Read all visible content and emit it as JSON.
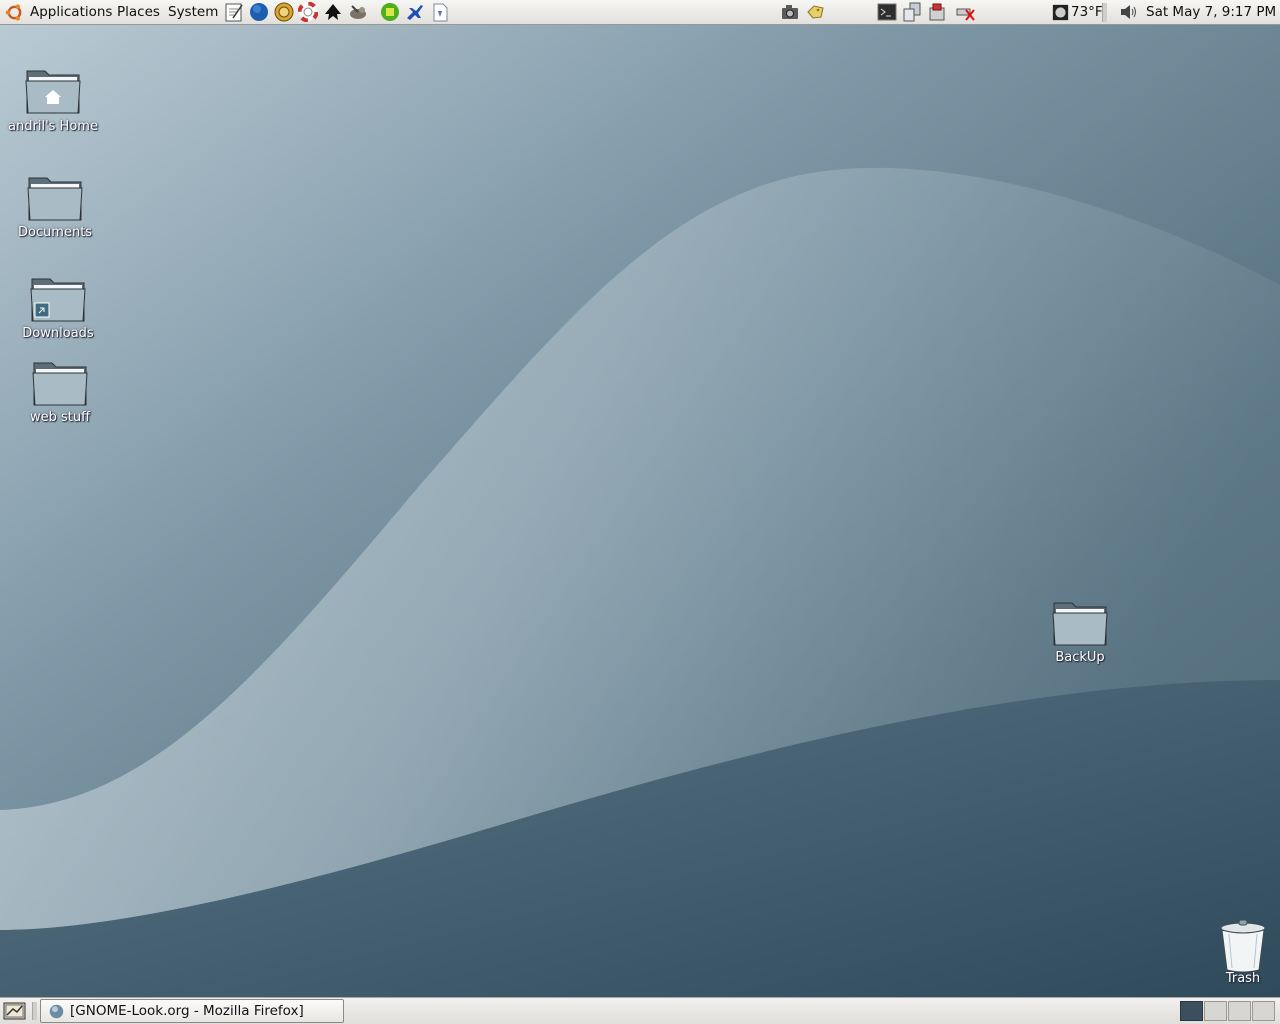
{
  "top_panel": {
    "menus": [
      "Applications",
      "Places",
      "System"
    ],
    "launchers": [
      "text-editor-icon",
      "globe-browser-icon",
      "tools-icon",
      "help-lifebuoy-icon",
      "inkscape-icon",
      "gimp-icon",
      "games-icon",
      "jet-icon",
      "document-icon"
    ],
    "tray_left": [
      "camera-icon",
      "tag-icon"
    ],
    "tray_right": [
      "terminal-icon",
      "windows-icon",
      "network-icon",
      "battery-disconnected-icon"
    ],
    "weather": "73°F",
    "volume_icon": "speaker-icon",
    "clock": "Sat May  7,  9:17 PM"
  },
  "desktop": {
    "icons": [
      {
        "label": "andril's Home",
        "type": "home-folder-icon"
      },
      {
        "label": "Documents",
        "type": "folder-icon"
      },
      {
        "label": "Downloads",
        "type": "link-folder-icon"
      },
      {
        "label": "web stuff",
        "type": "folder-icon"
      },
      {
        "label": "BackUp",
        "type": "folder-icon"
      },
      {
        "label": "Trash",
        "type": "trash-icon"
      }
    ]
  },
  "bottom_panel": {
    "task_label": "[GNOME-Look.org - Mozilla Firefox]",
    "workspaces": 4,
    "active_workspace": 1
  },
  "colors": {
    "desktop_dark": "#3a5566",
    "desktop_light": "#a8bcc7",
    "panel": "#e9e7e3"
  }
}
